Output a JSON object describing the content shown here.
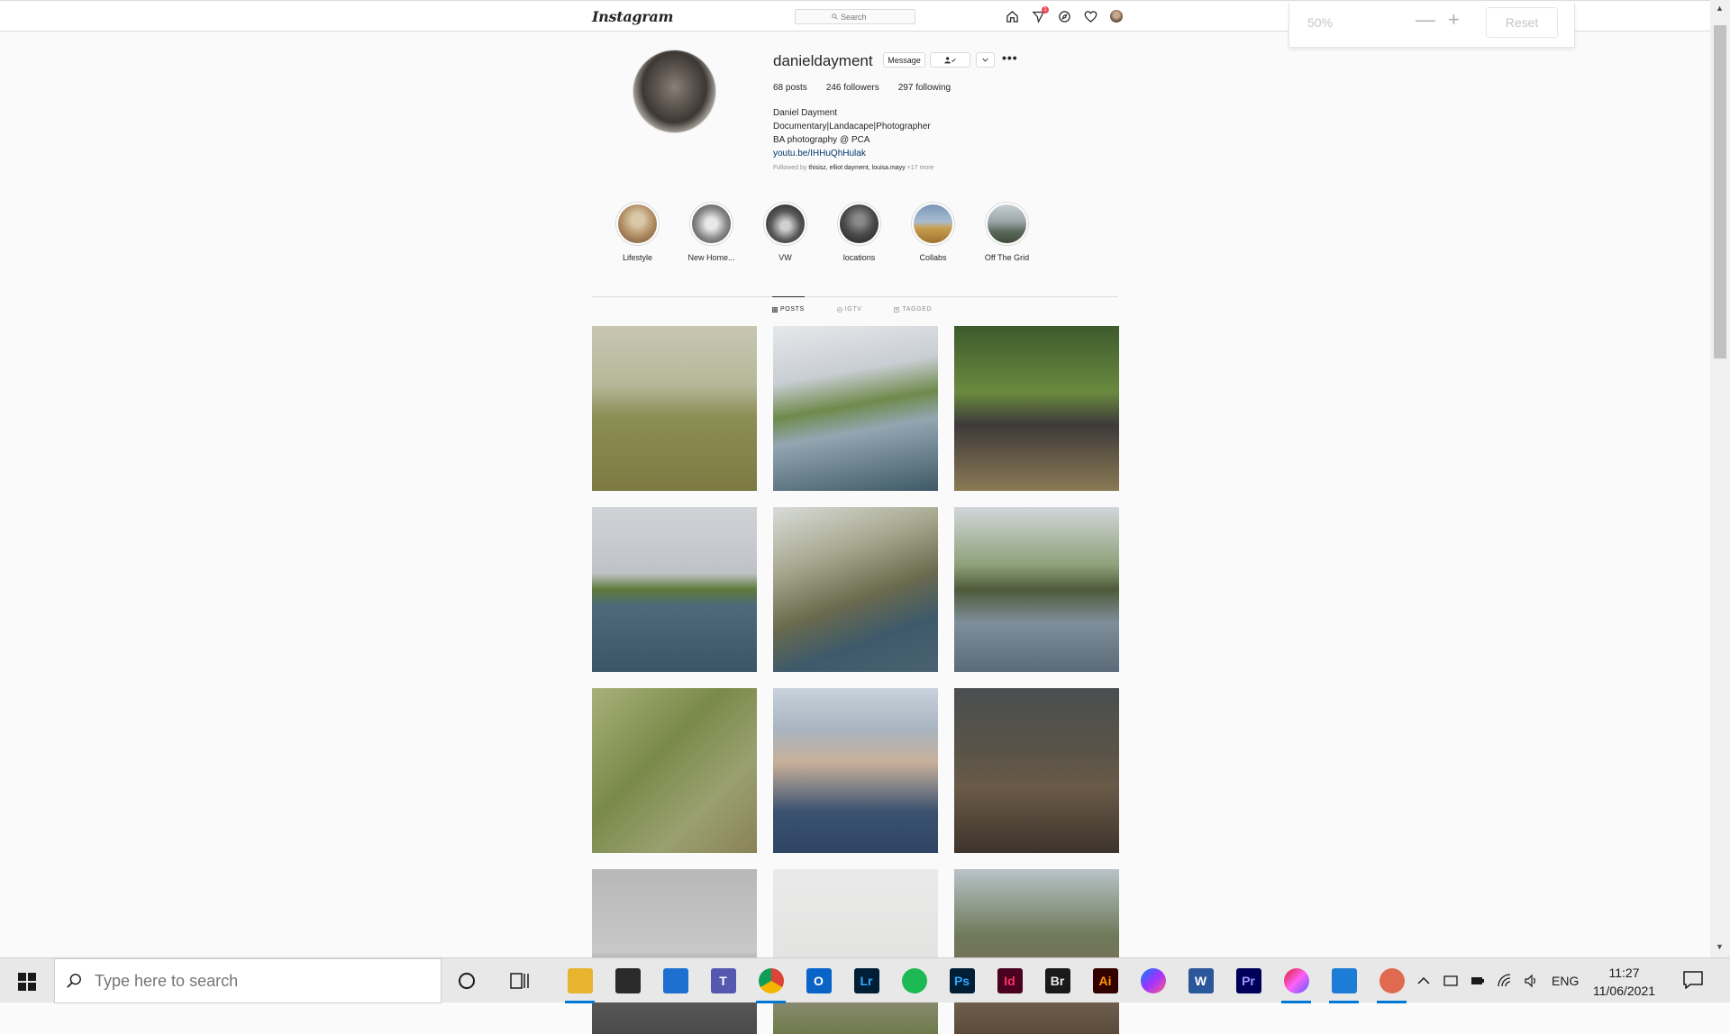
{
  "topbar": {
    "logo": "Instagram",
    "search_placeholder": "Search"
  },
  "zoom": {
    "level": "50%",
    "minus": "—",
    "plus": "+",
    "reset": "Reset"
  },
  "profile": {
    "username": "danieldayment",
    "message_label": "Message",
    "stats": {
      "posts": "68 posts",
      "followers": "246 followers",
      "following": "297 following"
    },
    "bio": {
      "name": "Daniel Dayment",
      "line1": "Documentary|Landacape|Photographer",
      "line2": "BA photography @ PCA",
      "link": "youtu.be/IHHuQhHulak"
    },
    "followed_prefix": "Followed by",
    "followed_names": "thisisz, elliot dayment, louisa.mayy",
    "followed_more": "+17 more"
  },
  "highlights": [
    {
      "label": "Lifestyle",
      "color": "#b08a60"
    },
    {
      "label": "New Home...",
      "color": "#8a8a8a"
    },
    {
      "label": "VW",
      "color": "#5a5a5a"
    },
    {
      "label": "locations",
      "color": "#4a4a4a"
    },
    {
      "label": "Collabs",
      "color": "#7a98b8"
    },
    {
      "label": "Off The Grid",
      "color": "#9aa4a8"
    }
  ],
  "tabs": {
    "posts": "POSTS",
    "igtv": "IGTV",
    "tagged": "TAGGED"
  },
  "taskbar": {
    "search_placeholder": "Type here to search",
    "lang": "ENG",
    "time": "11:27",
    "date": "11/06/2021",
    "apps": [
      {
        "name": "file-explorer-icon",
        "text": "",
        "color": "#e8b430",
        "running": true
      },
      {
        "name": "microsoft-store-icon",
        "text": "",
        "color": "#2a2a2a",
        "running": false
      },
      {
        "name": "mail-icon",
        "text": "",
        "color": "#1e6fd0",
        "running": false
      },
      {
        "name": "teams-icon",
        "text": "T",
        "color": "#5558af",
        "running": false
      },
      {
        "name": "chrome-icon",
        "text": "",
        "color": "#db4437",
        "running": true
      },
      {
        "name": "outlook-icon",
        "text": "O",
        "color": "#0a64c8",
        "running": false
      },
      {
        "name": "lightroom-icon",
        "text": "Lr",
        "color": "#001e36",
        "running": false
      },
      {
        "name": "spotify-icon",
        "text": "",
        "color": "#1db954",
        "running": false
      },
      {
        "name": "photoshop-icon",
        "text": "Ps",
        "color": "#001e36",
        "running": false
      },
      {
        "name": "indesign-icon",
        "text": "Id",
        "color": "#49021f",
        "running": false
      },
      {
        "name": "bridge-icon",
        "text": "Br",
        "color": "#1a1a1a",
        "running": false
      },
      {
        "name": "illustrator-icon",
        "text": "Ai",
        "color": "#330000",
        "running": false
      },
      {
        "name": "messenger-icon",
        "text": "",
        "color": "#8a4dff",
        "running": false
      },
      {
        "name": "word-icon",
        "text": "W",
        "color": "#2b579a",
        "running": false
      },
      {
        "name": "premiere-icon",
        "text": "Pr",
        "color": "#00005b",
        "running": false
      },
      {
        "name": "creative-cloud-icon",
        "text": "",
        "color": "#da1f26",
        "running": true
      },
      {
        "name": "video-player-icon",
        "text": "",
        "color": "#1c7cd6",
        "running": true
      },
      {
        "name": "snip-sketch-icon",
        "text": "",
        "color": "#e06a50",
        "running": true
      }
    ]
  },
  "posts": [
    {
      "g": "linear-gradient(180deg,#c8c6b2 0%,#b6b89a 35%,#8c8e54 55%,#7c7a42 100%)"
    },
    {
      "g": "linear-gradient(170deg,#e6e8ea 0%,#c9ced4 30%,#6f8a4c 48%,#93a6b1 62%,#3e5a66 100%)"
    },
    {
      "g": "linear-gradient(180deg,#3d5a2c 0%,#6a8a3e 40%,#3e3a3a 60%,#8a7a54 100%)"
    },
    {
      "g": "linear-gradient(180deg,#d0d3d6 0%,#bfc3c8 40%,#5e7a3a 50%,#4e6a7a 60%,#3c5566 100%)"
    },
    {
      "g": "linear-gradient(160deg,#d8dcd8 0%,#a8a890 30%,#6a6a4e 55%,#3e5a6a 75%,#4a6272 100%)"
    },
    {
      "g": "linear-gradient(180deg,#d2d6da 0%,#8ea27a 35%,#4e5a3a 50%,#7e8e9a 70%,#5a6a78 100%)"
    },
    {
      "g": "linear-gradient(135deg,#a8b07a 0%,#7a8a4a 40%,#9aa070 70%,#8a8258 100%)"
    },
    {
      "g": "linear-gradient(180deg,#c8d2dc 0%,#a8b4c0 25%,#c8b09a 45%,#3a5270 75%,#2e4462 100%)"
    },
    {
      "g": "linear-gradient(180deg,#4a4e50 0%,#5a5448 40%,#6a5a48 60%,#3e342c 100%)"
    },
    {
      "g": "linear-gradient(180deg,#b8b8b8 0%,#c8c8c8 50%,#5a5a5a 75%,#4a4a4a 100%)"
    },
    {
      "g": "linear-gradient(180deg,#eaeaea 0%,#e2e2e0 60%,#8a8a70 80%,#6e7a4a 100%)"
    },
    {
      "g": "linear-gradient(180deg,#b8c4c8 0%,#6e7a5a 40%,#7a6a5a 70%,#5a4a3a 100%)"
    }
  ]
}
